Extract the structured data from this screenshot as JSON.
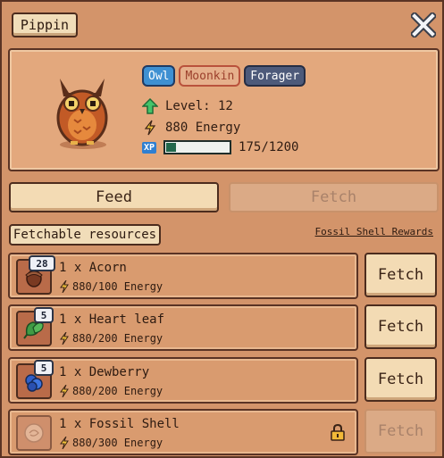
{
  "pet": {
    "name": "Pippin",
    "tags": [
      "Owl",
      "Moonkin",
      "Forager"
    ],
    "level_text": "Level: 12",
    "energy_text": "880 Energy",
    "xp_badge": "XP",
    "xp_text": "175/1200",
    "xp_current": 175,
    "xp_max": 1200
  },
  "tabs": {
    "feed": "Feed",
    "fetch": "Fetch"
  },
  "section": {
    "label": "Fetchable resources",
    "rewards_link": "Fossil Shell Rewards"
  },
  "resources": [
    {
      "count": "28",
      "name": "1 x Acorn",
      "cost": "880/100 Energy",
      "button": "Fetch",
      "enabled": true,
      "locked": false,
      "icon": "acorn-icon"
    },
    {
      "count": "5",
      "name": "1 x Heart leaf",
      "cost": "880/200 Energy",
      "button": "Fetch",
      "enabled": true,
      "locked": false,
      "icon": "heart-leaf-icon"
    },
    {
      "count": "5",
      "name": "1 x Dewberry",
      "cost": "880/200 Energy",
      "button": "Fetch",
      "enabled": true,
      "locked": false,
      "icon": "dewberry-icon"
    },
    {
      "count": "",
      "name": "1 x Fossil Shell",
      "cost": "880/300 Energy",
      "button": "Fetch",
      "enabled": false,
      "locked": true,
      "icon": "fossil-shell-icon"
    }
  ],
  "colors": {
    "accent_blue": "#3e90d2",
    "xp_green": "#22684c",
    "panel": "#d3946a"
  }
}
